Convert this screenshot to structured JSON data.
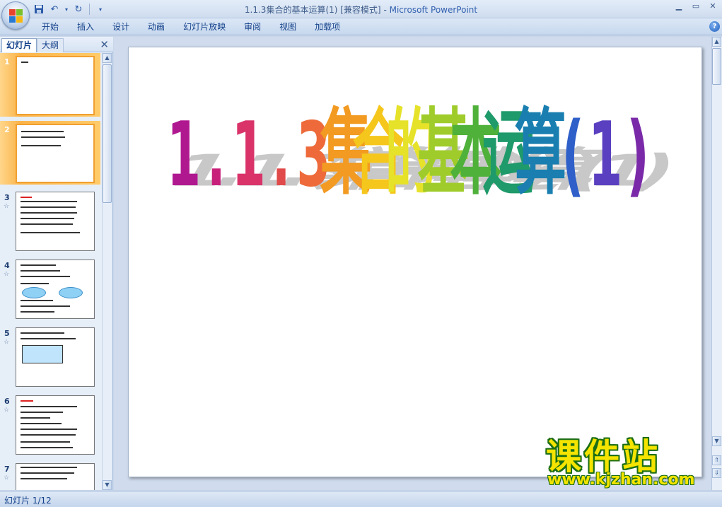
{
  "window": {
    "title": "1.1.3集合的基本运算(1) [兼容模式]",
    "title_sep": " - ",
    "app": "Microsoft PowerPoint"
  },
  "ribbon": {
    "tabs": [
      "开始",
      "插入",
      "设计",
      "动画",
      "幻灯片放映",
      "审阅",
      "视图",
      "加载项"
    ]
  },
  "pane": {
    "tab_slides": "幻灯片",
    "tab_outline": "大纲",
    "slides": [
      {
        "num": "1",
        "selected": true
      },
      {
        "num": "2",
        "selected": true
      },
      {
        "num": "3",
        "selected": false
      },
      {
        "num": "4",
        "selected": false
      },
      {
        "num": "5",
        "selected": false
      },
      {
        "num": "6",
        "selected": false
      },
      {
        "num": "7",
        "selected": false
      }
    ]
  },
  "slide": {
    "title_chars": [
      "1",
      ".",
      "1",
      ".",
      "3",
      "集",
      "合",
      "的",
      "基",
      "本",
      "运",
      "算",
      "(",
      "1",
      ")"
    ],
    "title_colors": [
      "#b01890",
      "#c8207a",
      "#d9336a",
      "#e04a4a",
      "#ee6a3a",
      "#f29a22",
      "#f5c61c",
      "#e6e22a",
      "#9fcc2a",
      "#4fb13a",
      "#1f9a6a",
      "#1a7fb0",
      "#2f5fc8",
      "#5a3fc0",
      "#7a2aa8"
    ]
  },
  "watermark": {
    "cn": "课件站",
    "url": "www.kjzhan.com"
  },
  "status": {
    "text": "幻灯片 1/12"
  }
}
